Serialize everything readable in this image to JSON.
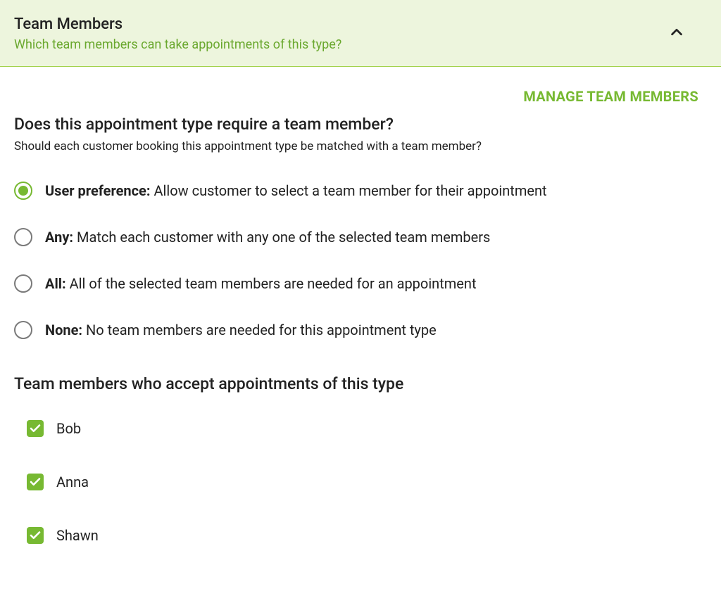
{
  "header": {
    "title": "Team Members",
    "subtitle": "Which team members can take appointments of this type?"
  },
  "manage_link": "MANAGE TEAM MEMBERS",
  "require_section": {
    "title": "Does this appointment type require a team member?",
    "description": "Should each customer booking this appointment type be matched with a team member?"
  },
  "radio_options": [
    {
      "label_bold": "User preference:",
      "label_rest": " Allow customer to select a team member for their appointment",
      "selected": true
    },
    {
      "label_bold": "Any:",
      "label_rest": " Match each customer with any one of the selected team members",
      "selected": false
    },
    {
      "label_bold": "All:",
      "label_rest": " All of the selected team members are needed for an appointment",
      "selected": false
    },
    {
      "label_bold": "None:",
      "label_rest": " No team members are needed for this appointment type",
      "selected": false
    }
  ],
  "members_title": "Team members who accept appointments of this type",
  "team_members": [
    {
      "name": "Bob",
      "checked": true
    },
    {
      "name": "Anna",
      "checked": true
    },
    {
      "name": "Shawn",
      "checked": true
    }
  ],
  "colors": {
    "accent": "#77b932",
    "header_bg": "#edf5dd"
  }
}
